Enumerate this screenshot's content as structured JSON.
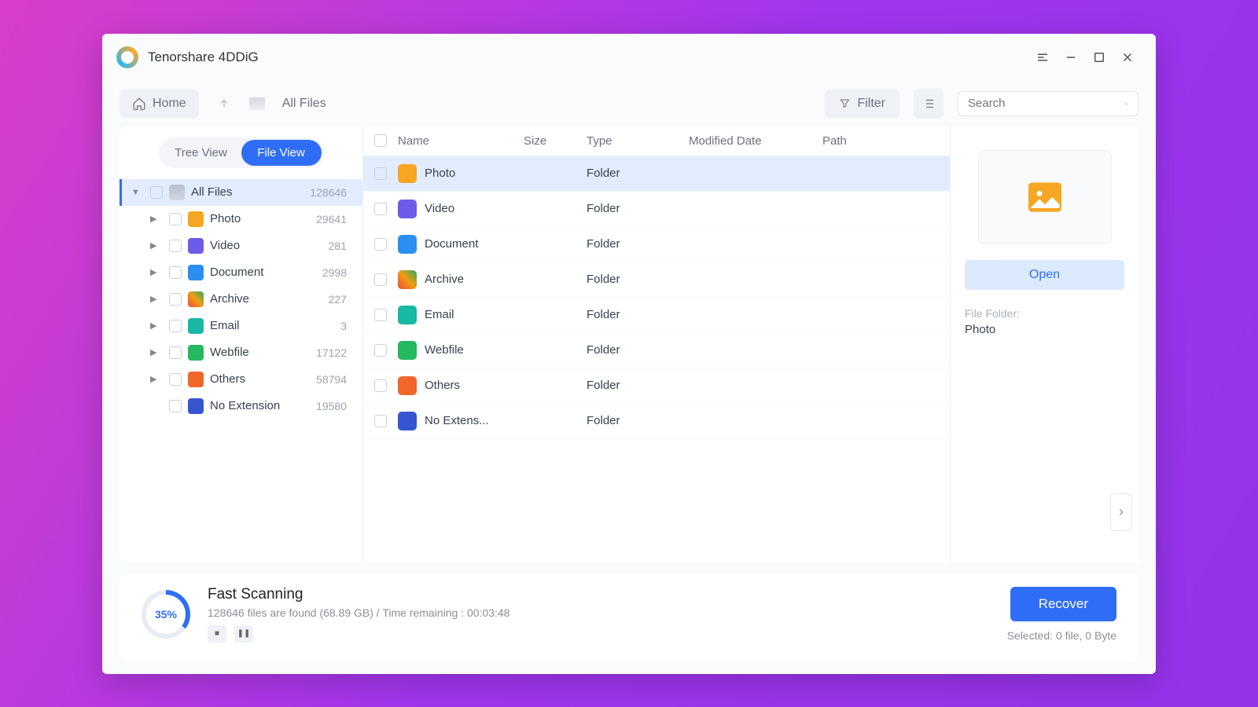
{
  "app": {
    "title": "Tenorshare 4DDiG"
  },
  "toolbar": {
    "home": "Home",
    "breadcrumb": "All Files",
    "filter": "Filter",
    "search_placeholder": "Search"
  },
  "tabs": {
    "tree": "Tree View",
    "file": "File View"
  },
  "tree": {
    "root": {
      "label": "All Files",
      "count": "128646"
    },
    "children": [
      {
        "label": "Photo",
        "count": "29641",
        "cls": "ic-photo"
      },
      {
        "label": "Video",
        "count": "281",
        "cls": "ic-video"
      },
      {
        "label": "Document",
        "count": "2998",
        "cls": "ic-doc"
      },
      {
        "label": "Archive",
        "count": "227",
        "cls": "ic-arch"
      },
      {
        "label": "Email",
        "count": "3",
        "cls": "ic-email"
      },
      {
        "label": "Webfile",
        "count": "17122",
        "cls": "ic-web"
      },
      {
        "label": "Others",
        "count": "58794",
        "cls": "ic-other"
      },
      {
        "label": "No Extension",
        "count": "19580",
        "cls": "ic-noext"
      }
    ]
  },
  "columns": {
    "name": "Name",
    "size": "Size",
    "type": "Type",
    "modified": "Modified Date",
    "path": "Path"
  },
  "rows": [
    {
      "name": "Photo",
      "type": "Folder",
      "cls": "ic-photo",
      "selected": true
    },
    {
      "name": "Video",
      "type": "Folder",
      "cls": "ic-video"
    },
    {
      "name": "Document",
      "type": "Folder",
      "cls": "ic-doc"
    },
    {
      "name": "Archive",
      "type": "Folder",
      "cls": "ic-arch"
    },
    {
      "name": "Email",
      "type": "Folder",
      "cls": "ic-email"
    },
    {
      "name": "Webfile",
      "type": "Folder",
      "cls": "ic-web"
    },
    {
      "name": "Others",
      "type": "Folder",
      "cls": "ic-other"
    },
    {
      "name": "No Extens...",
      "type": "Folder",
      "cls": "ic-noext"
    }
  ],
  "preview": {
    "open": "Open",
    "meta_label": "File Folder:",
    "meta_value": "Photo"
  },
  "footer": {
    "pct": "35%",
    "title": "Fast Scanning",
    "sub": "128646 files are found (68.89 GB) /  Time remaining : 00:03:48",
    "recover": "Recover",
    "selected": "Selected: 0 file, 0 Byte"
  }
}
